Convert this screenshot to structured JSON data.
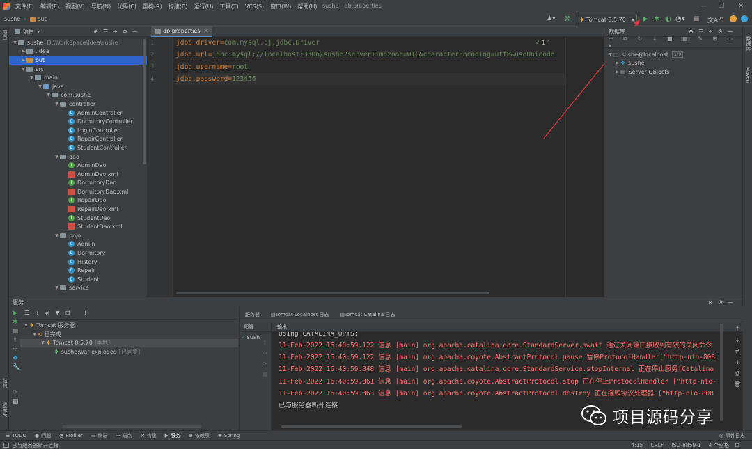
{
  "menubar": {
    "items": [
      "文件(F)",
      "编辑(E)",
      "视图(V)",
      "导航(N)",
      "代码(C)",
      "重构(R)",
      "构建(B)",
      "运行(U)",
      "工具(T)",
      "VCS(S)",
      "窗口(W)",
      "帮助(H)"
    ],
    "window_title": "sushe - db.properties"
  },
  "navbar": {
    "crumbs": [
      "sushe",
      "out"
    ],
    "run_config": "Tomcat 8.5.70"
  },
  "left_strip": {
    "top_label": "项目",
    "bottom_labels": [
      "结构",
      "收藏夹"
    ]
  },
  "right_strip": {
    "labels": [
      "数据库",
      "Maven"
    ]
  },
  "project": {
    "title": "项目",
    "tree": [
      {
        "label": "sushe",
        "hint": "D:\\WorkSpace\\Idea\\sushe",
        "depth": 0,
        "kind": "folder",
        "open": true
      },
      {
        "label": ".idea",
        "depth": 1,
        "kind": "folder",
        "open": false
      },
      {
        "label": "out",
        "depth": 1,
        "kind": "folder-orange",
        "open": false,
        "selected": true
      },
      {
        "label": "src",
        "depth": 1,
        "kind": "folder",
        "open": true
      },
      {
        "label": "main",
        "depth": 2,
        "kind": "folder",
        "open": true
      },
      {
        "label": "java",
        "depth": 3,
        "kind": "folder-blue",
        "open": true
      },
      {
        "label": "com.sushe",
        "depth": 4,
        "kind": "folder",
        "open": true
      },
      {
        "label": "controller",
        "depth": 5,
        "kind": "folder",
        "open": true
      },
      {
        "label": "AdminController",
        "depth": 6,
        "kind": "class"
      },
      {
        "label": "DormitoryController",
        "depth": 6,
        "kind": "class"
      },
      {
        "label": "LoginController",
        "depth": 6,
        "kind": "class"
      },
      {
        "label": "RepairController",
        "depth": 6,
        "kind": "class"
      },
      {
        "label": "StudentController",
        "depth": 6,
        "kind": "class"
      },
      {
        "label": "dao",
        "depth": 5,
        "kind": "folder",
        "open": true
      },
      {
        "label": "AdminDao",
        "depth": 6,
        "kind": "interface"
      },
      {
        "label": "AdminDao.xml",
        "depth": 6,
        "kind": "xml"
      },
      {
        "label": "DormitoryDao",
        "depth": 6,
        "kind": "interface"
      },
      {
        "label": "DormitoryDao.xml",
        "depth": 6,
        "kind": "xml"
      },
      {
        "label": "RepairDao",
        "depth": 6,
        "kind": "interface"
      },
      {
        "label": "RepairDao.xml",
        "depth": 6,
        "kind": "xml"
      },
      {
        "label": "StudentDao",
        "depth": 6,
        "kind": "interface"
      },
      {
        "label": "StudentDao.xml",
        "depth": 6,
        "kind": "xml"
      },
      {
        "label": "pojo",
        "depth": 5,
        "kind": "folder",
        "open": true
      },
      {
        "label": "Admin",
        "depth": 6,
        "kind": "class"
      },
      {
        "label": "Dormitory",
        "depth": 6,
        "kind": "class"
      },
      {
        "label": "History",
        "depth": 6,
        "kind": "class"
      },
      {
        "label": "Repair",
        "depth": 6,
        "kind": "class"
      },
      {
        "label": "Student",
        "depth": 6,
        "kind": "class"
      },
      {
        "label": "service",
        "depth": 5,
        "kind": "folder",
        "open": true
      }
    ]
  },
  "editor": {
    "tab": "db.properties",
    "inspection": "1",
    "lines": [
      {
        "num": "1",
        "key": "jdbc.driver",
        "value": "com.mysql.cj.jdbc.Driver"
      },
      {
        "num": "2",
        "key": "jdbc.url",
        "value": "jdbc:mysql://localhost:3306/sushe?serverTimezone=UTC&characterEncoding=utf8&useUnicode"
      },
      {
        "num": "3",
        "key": "jdbc.username",
        "value": "root"
      },
      {
        "num": "4",
        "key": "jdbc.password",
        "value": "123456"
      }
    ]
  },
  "database": {
    "title": "数据库",
    "tree": [
      {
        "label": "sushe@localhost",
        "badge": "1/9",
        "depth": 0
      },
      {
        "label": "sushe",
        "depth": 1
      },
      {
        "label": "Server Objects",
        "depth": 1
      }
    ]
  },
  "services": {
    "title": "服务",
    "tree": [
      {
        "label": "Tomcat 服务器",
        "depth": 0
      },
      {
        "label": "已完成",
        "depth": 1
      },
      {
        "label": "Tomcat 8.5.70",
        "hint": "[本地]",
        "depth": 2,
        "selected": true
      },
      {
        "label": "sushe:war exploded",
        "hint": "[已同步]",
        "depth": 3
      }
    ],
    "tabs": [
      "服务器",
      "Tomcat Localhost 日志",
      "Tomcat Catalina 日志"
    ],
    "deploy_header": "部署",
    "deploy_item": "sush",
    "output_header": "输出",
    "log_partial": "Using CATALINA_OPTS:",
    "log": [
      "11-Feb-2022 16:40:59.122 信息 [main] org.apache.catalina.core.StandardServer.await 通过关闭端口接收到有效的关闭命令",
      "11-Feb-2022 16:40:59.122 信息 [main] org.apache.coyote.AbstractProtocol.pause 暂停ProtocolHandler[\"http-nio-808",
      "11-Feb-2022 16:40:59.348 信息 [main] org.apache.catalina.core.StandardService.stopInternal 正在停止服务[Catalina",
      "11-Feb-2022 16:40:59.361 信息 [main] org.apache.coyote.AbstractProtocol.stop 正在停止ProtocolHandler [\"http-nio-",
      "11-Feb-2022 16:40:59.363 信息 [main] org.apache.coyote.AbstractProtocol.destroy 正在摧毁协议处理器 [\"http-nio-808"
    ],
    "disconnected": "已与服务器断开连接"
  },
  "toolwindows": [
    "TODO",
    "问题",
    "Profiler",
    "终端",
    "端点",
    "构建",
    "服务",
    "依赖项",
    "Spring"
  ],
  "event_log": "事件日志",
  "status": {
    "message": "已与服务器断开连接",
    "position": "4:15",
    "line_sep": "CRLF",
    "encoding": "ISO-8859-1",
    "indent": "4 个空格"
  },
  "watermark": "项目源码分享",
  "colors": {
    "accent": "#4a88c7",
    "arrow": "#e0393e",
    "selection": "#2f65ca"
  }
}
